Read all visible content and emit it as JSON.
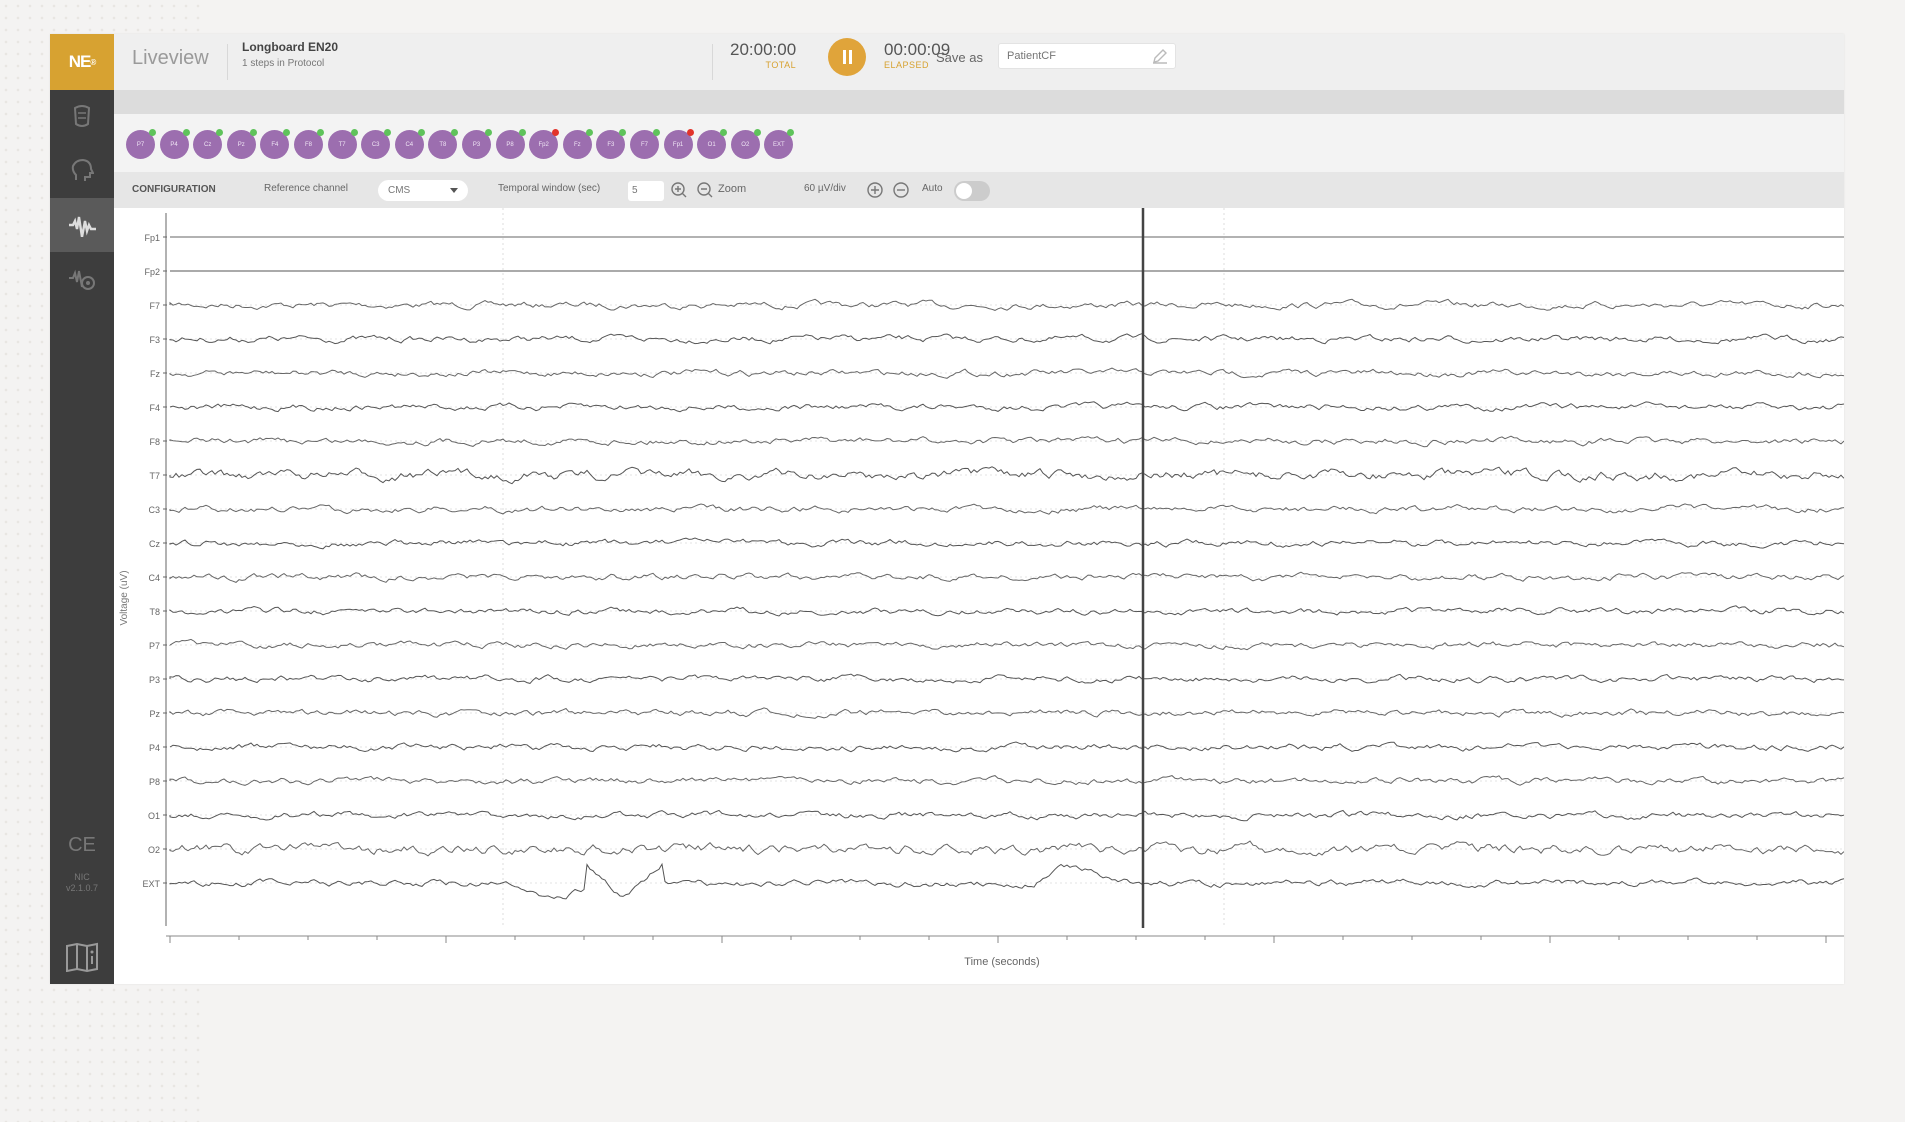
{
  "header": {
    "logo": "NE",
    "title": "Liveview",
    "protocol_name": "Longboard EN20",
    "protocol_steps": "1 steps in Protocol",
    "total_time": "20:00:00",
    "total_label": "TOTAL",
    "elapsed_time": "00:00:09",
    "elapsed_label": "ELAPSED",
    "save_as_label": "Save as",
    "save_as_placeholder": "PatientCF"
  },
  "sidebar": {
    "items": [
      {
        "icon": "cap-icon"
      },
      {
        "icon": "head-icon"
      },
      {
        "icon": "waveform-icon",
        "active": true
      },
      {
        "icon": "stimulation-icon"
      }
    ],
    "ce_mark": "CE",
    "version_label": "NIC v2.1.0.7"
  },
  "electrodes": [
    {
      "label": "P7",
      "status": "#5fc35b"
    },
    {
      "label": "P4",
      "status": "#5fc35b"
    },
    {
      "label": "Cz",
      "status": "#5fc35b"
    },
    {
      "label": "Pz",
      "status": "#5fc35b"
    },
    {
      "label": "F4",
      "status": "#5fc35b"
    },
    {
      "label": "F8",
      "status": "#5fc35b"
    },
    {
      "label": "T7",
      "status": "#5fc35b"
    },
    {
      "label": "C3",
      "status": "#5fc35b"
    },
    {
      "label": "C4",
      "status": "#5fc35b"
    },
    {
      "label": "T8",
      "status": "#5fc35b"
    },
    {
      "label": "P3",
      "status": "#5fc35b"
    },
    {
      "label": "P8",
      "status": "#5fc35b"
    },
    {
      "label": "Fp2",
      "status": "#e2342b"
    },
    {
      "label": "Fz",
      "status": "#5fc35b"
    },
    {
      "label": "F3",
      "status": "#5fc35b"
    },
    {
      "label": "F7",
      "status": "#5fc35b"
    },
    {
      "label": "Fp1",
      "status": "#e2342b"
    },
    {
      "label": "O1",
      "status": "#5fc35b"
    },
    {
      "label": "O2",
      "status": "#5fc35b"
    },
    {
      "label": "EXT",
      "status": "#5fc35b"
    }
  ],
  "config": {
    "title": "CONFIGURATION",
    "reference_label": "Reference channel",
    "reference_value": "CMS",
    "temporal_label": "Temporal window (sec)",
    "temporal_value": "5",
    "zoom_label": "Zoom",
    "scale_label": "60 µV/div",
    "auto_label": "Auto"
  },
  "chart_data": {
    "type": "line",
    "ylabel": "Voltage (uV)",
    "xlabel": "Time (seconds)",
    "channels": [
      "Fp1",
      "Fp2",
      "F7",
      "F3",
      "Fz",
      "F4",
      "F8",
      "T7",
      "C3",
      "Cz",
      "C4",
      "T8",
      "P7",
      "P3",
      "Pz",
      "P4",
      "P8",
      "O1",
      "O2",
      "EXT"
    ],
    "flat_channels": [
      "Fp1",
      "Fp2"
    ]
  },
  "colors": {
    "accent": "#d7a231",
    "electrode": "#9c6eaf",
    "status_ok": "#5fc35b",
    "status_bad": "#e2342b",
    "sidebar": "#3d3d3d"
  }
}
